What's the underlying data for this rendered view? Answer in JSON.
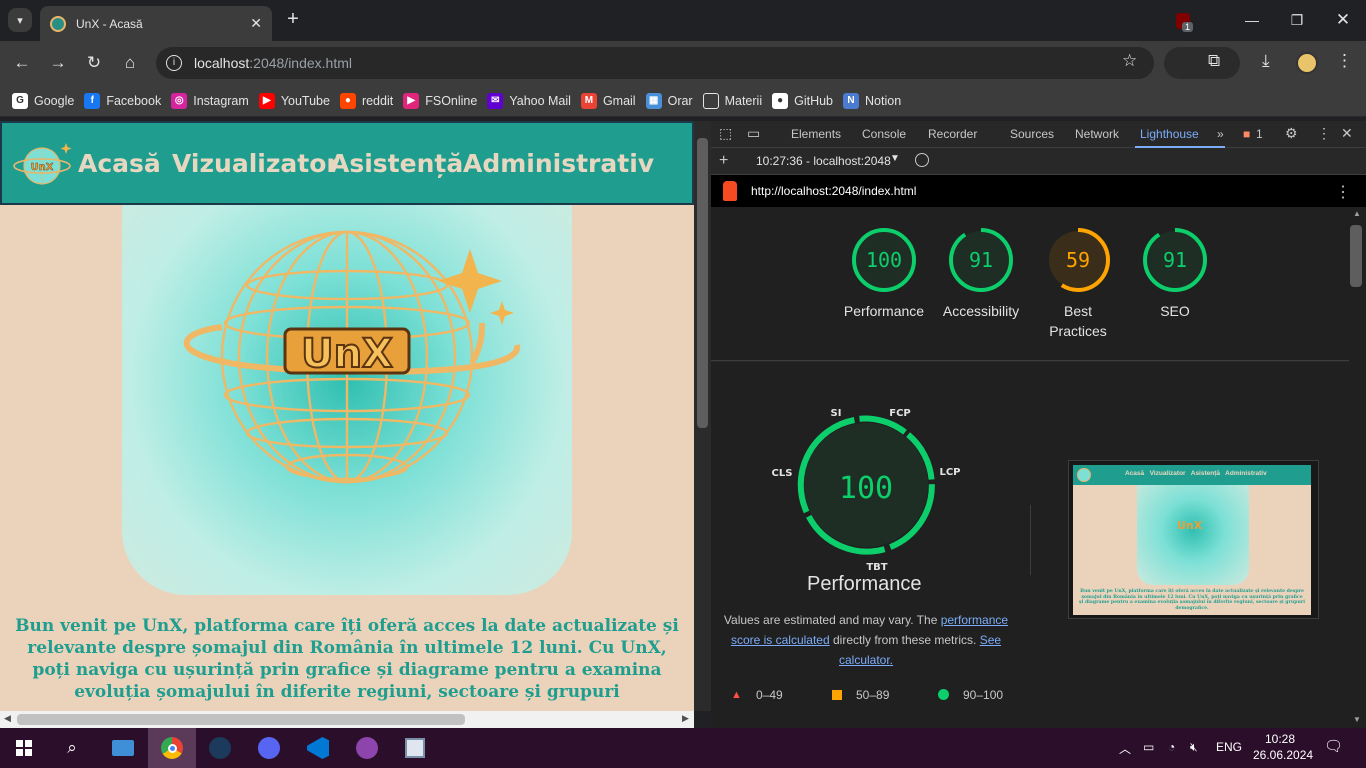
{
  "browser": {
    "tab_title": "UnX - Acasă",
    "url_host": "localhost",
    "url_path": ":2048/index.html"
  },
  "bookmarks": [
    {
      "label": "Google",
      "icon": "google-icon",
      "color": "#ffffff"
    },
    {
      "label": "Facebook",
      "icon": "facebook-icon",
      "color": "#1877f2"
    },
    {
      "label": "Instagram",
      "icon": "instagram-icon",
      "color": "#d6249f"
    },
    {
      "label": "YouTube",
      "icon": "youtube-icon",
      "color": "#ff0000"
    },
    {
      "label": "reddit",
      "icon": "reddit-icon",
      "color": "#ff4500"
    },
    {
      "label": "FSOnline",
      "icon": "fsonline-icon",
      "color": "#e0257a"
    },
    {
      "label": "Yahoo Mail",
      "icon": "yahoo-mail-icon",
      "color": "#6001d2"
    },
    {
      "label": "Gmail",
      "icon": "gmail-icon",
      "color": "#ea4335"
    },
    {
      "label": "Orar",
      "icon": "orar-icon",
      "color": "#4a90d9"
    },
    {
      "label": "Materii",
      "icon": "folder-icon",
      "color": "#3c3c3c"
    },
    {
      "label": "GitHub",
      "icon": "github-icon",
      "color": "#ffffff"
    },
    {
      "label": "Notion",
      "icon": "notion-icon",
      "color": "#4a7bd0"
    }
  ],
  "site": {
    "logo_text": "UnX",
    "nav": [
      "Acasă",
      "Vizualizator",
      "Asistență",
      "Administrativ"
    ],
    "hero_logo_text": "UnX",
    "welcome": "Bun venit pe UnX, platforma care îți oferă acces la date actualizate și relevante despre șomajul din România în ultimele 12 luni. Cu UnX, poți naviga cu ușurință prin grafice și diagrame pentru a examina evoluția șomajului în diferite regiuni, sectoare și grupuri"
  },
  "devtools": {
    "tabs": [
      "Elements",
      "Console",
      "Recorder",
      "Sources",
      "Network",
      "Lighthouse"
    ],
    "issues_count": "1",
    "report_selector": "10:27:36 - localhost:2048",
    "report_url": "http://localhost:2048/index.html",
    "scores": [
      {
        "label": "Performance",
        "value": "100",
        "color": "#0cce6b",
        "fraction": 1.0
      },
      {
        "label": "Accessibility",
        "value": "91",
        "color": "#0cce6b",
        "fraction": 0.91
      },
      {
        "label": "Best Practices",
        "value": "59",
        "color": "#ffa400",
        "fraction": 0.59
      },
      {
        "label": "SEO",
        "value": "91",
        "color": "#0cce6b",
        "fraction": 0.91
      }
    ],
    "perf": {
      "score": "100",
      "title": "Performance",
      "metric_labels": {
        "si": "SI",
        "fcp": "FCP",
        "lcp": "LCP",
        "tbt": "TBT",
        "cls": "CLS"
      },
      "note_prefix": "Values are estimated and may vary. The ",
      "note_link1": "performance score is calculated",
      "note_mid": " directly from these metrics. ",
      "note_link2": "See calculator."
    },
    "legend": [
      {
        "label": "0–49",
        "color": "#ff4e42",
        "shape": "triangle"
      },
      {
        "label": "50–89",
        "color": "#ffa400",
        "shape": "square"
      },
      {
        "label": "90–100",
        "color": "#0cce6b",
        "shape": "circle"
      }
    ],
    "thumb": {
      "nav": "Acasă   Vizualizator   Asistență   Administrativ",
      "logo": "UnX",
      "welcome": "Bun venit pe UnX, platforma care îți oferă acces la date actualizate și relevante despre șomajul din România în ultimele 12 luni. Cu UnX, poți naviga cu ușurință prin grafice și diagrame pentru a examina evoluția șomajului în diferite regiuni, sectoare și grupuri demografice."
    }
  },
  "taskbar": {
    "language": "ENG",
    "time": "10:28",
    "date": "26.06.2024"
  }
}
